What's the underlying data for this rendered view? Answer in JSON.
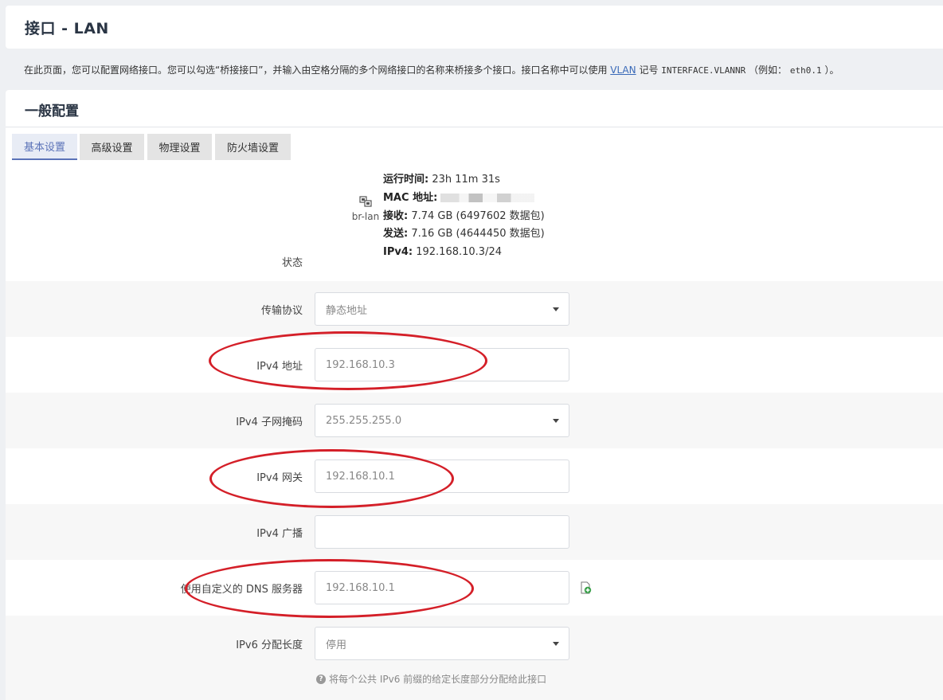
{
  "page": {
    "title": "接口 - LAN",
    "description": {
      "part1": "在此页面，您可以配置网络接口。您可以勾选“桥接接口”，并输入由空格分隔的多个网络接口的名称来桥接多个接口。接口名称中可以使用 ",
      "vlan": "VLAN",
      "part2": " 记号 ",
      "mono1": "INTERFACE.VLANNR",
      "part3": " （例如： ",
      "mono2": "eth0.1",
      "part4": " ）。"
    }
  },
  "section": {
    "title": "一般配置",
    "tabs": [
      {
        "label": "基本设置",
        "active": true
      },
      {
        "label": "高级设置",
        "active": false
      },
      {
        "label": "物理设置",
        "active": false
      },
      {
        "label": "防火墙设置",
        "active": false
      }
    ]
  },
  "status": {
    "label": "状态",
    "interface": {
      "name": "br-lan",
      "icon": "ethernet-bridge-icon"
    },
    "uptime_label": "运行时间:",
    "uptime_value": "23h 11m 31s",
    "mac_label": "MAC 地址:",
    "rx_label": "接收:",
    "rx_value": "7.74 GB (6497602 数据包)",
    "tx_label": "发送:",
    "tx_value": "7.16 GB (4644450 数据包)",
    "ipv4_label": "IPv4:",
    "ipv4_value": "192.168.10.3/24"
  },
  "fields": {
    "protocol": {
      "label": "传输协议",
      "value": "静态地址"
    },
    "ipv4_addr": {
      "label": "IPv4 地址",
      "value": "192.168.10.3"
    },
    "netmask": {
      "label": "IPv4 子网掩码",
      "value": "255.255.255.0"
    },
    "gateway": {
      "label": "IPv4 网关",
      "value": "192.168.10.1"
    },
    "broadcast": {
      "label": "IPv4 广播",
      "value": ""
    },
    "dns": {
      "label": "使用自定义的 DNS 服务器",
      "value": "192.168.10.1"
    },
    "ip6assign": {
      "label": "IPv6 分配长度",
      "value": "停用",
      "hint": "将每个公共 IPv6 前缀的给定长度部分分配给此接口"
    }
  },
  "colors": {
    "accent": "#5a72b8",
    "annotation": "#d41f28"
  }
}
